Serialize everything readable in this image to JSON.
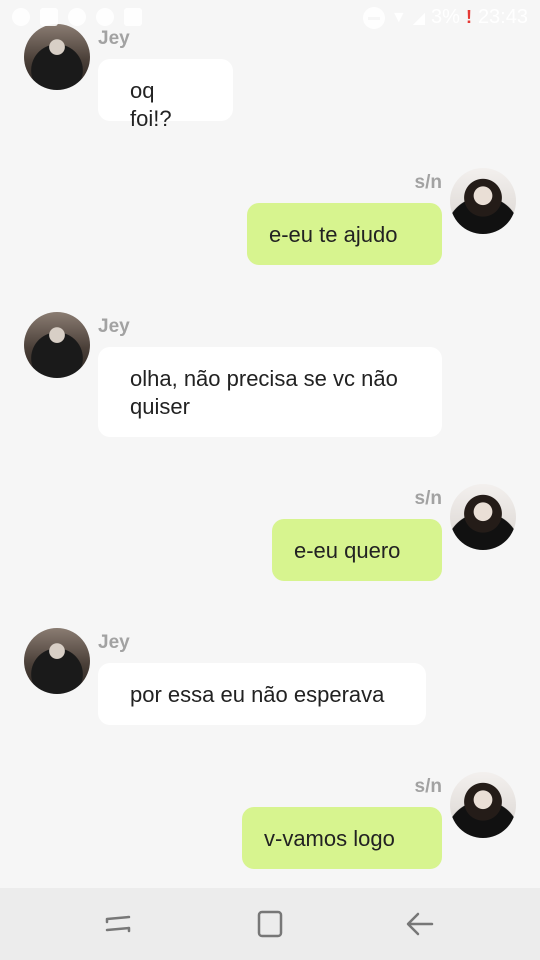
{
  "status_bar": {
    "battery_text": "3%",
    "time": "23:43"
  },
  "chat": {
    "messages": [
      {
        "sender": "Jey",
        "side": "in",
        "text": "oq foi!?"
      },
      {
        "sender": "s/n",
        "side": "out",
        "text": "e-eu te ajudo"
      },
      {
        "sender": "Jey",
        "side": "in",
        "text": "olha, não precisa se vc não quiser"
      },
      {
        "sender": "s/n",
        "side": "out",
        "text": "e-eu quero"
      },
      {
        "sender": "Jey",
        "side": "in",
        "text": "por essa eu não esperava"
      },
      {
        "sender": "s/n",
        "side": "out",
        "text": "v-vamos logo"
      }
    ]
  },
  "colors": {
    "incoming_bubble": "#ffffff",
    "outgoing_bubble": "#d7f48f",
    "background": "#f6f6f6",
    "sender_name": "#a2a2a2"
  },
  "icons": {
    "nav_recents": "recent-apps-icon",
    "nav_home": "home-icon",
    "nav_back": "back-arrow-icon"
  }
}
